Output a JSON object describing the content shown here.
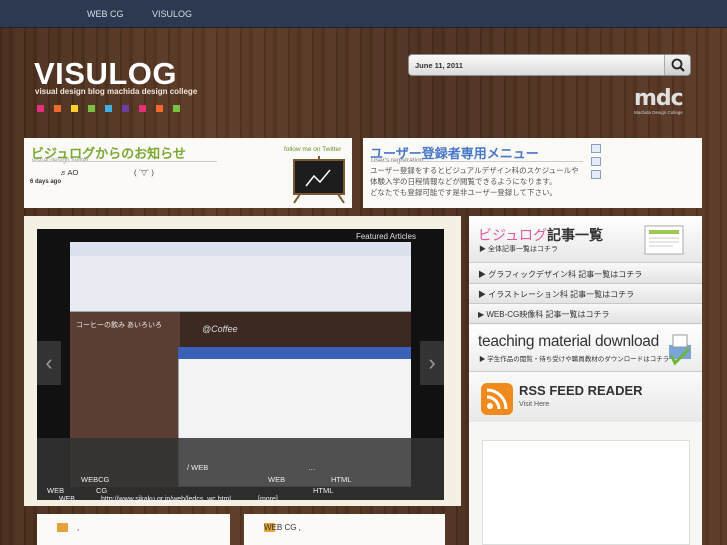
{
  "topnav": [
    "WEB CG",
    "VISULOG"
  ],
  "header": {
    "logo": "VISULOG",
    "tagline": "visual design blog machida design college",
    "square_colors": [
      "#e6307a",
      "#f26a2a",
      "#fcd12a",
      "#7ac143",
      "#3fb0e4",
      "#6b3fa0",
      "#e6307a",
      "#f26a2a",
      "#7ac143"
    ],
    "date": "June 11, 2011",
    "brand": "mdc",
    "brand_sub": "Machida Design College"
  },
  "news": {
    "title": "ビジュログからのお知らせ",
    "subtitle": "visual design twitter",
    "follow": "follow me on Twitter",
    "item_text": "♬AO",
    "item_emoticon": "( ´▽` )",
    "age": "6 days ago"
  },
  "registration": {
    "title": "ユーザー登録者専用メニュー",
    "subtitle": "User's registration",
    "lines": [
      "ユーザー登録をするとビジュアルデザイン科のスケジュールや",
      "体験入学の日程情報などが閲覧できるようになります。",
      "どなたでも登録可能です是非ユーザー登録して下さい。"
    ]
  },
  "slider": {
    "featured_label": "Featured Articles",
    "prev_icon": "chevron-left-icon",
    "next_icon": "chevron-right-icon",
    "overlay": {
      "line1_a": "/ WEB",
      "line1_b": "…",
      "line2_a": "WEB",
      "line2_b": "HTML",
      "line3_a": "WEBCG",
      "line4_a": "WEB",
      "line4_b": "CG",
      "line4_c": "HTML",
      "line5_a": "WEB",
      "line5_b": "http://www.sikaku.gr.jp/web/ledcs_wc.html",
      "line5_c": "[more]"
    },
    "screenshot_text": "@Coffee",
    "screenshot_heading": "コーヒーの飲み あいろいろ"
  },
  "sidebar": {
    "articles_title_a": "ビジュログ",
    "articles_title_b": "記事一覧",
    "articles_sub": "▶ 全体記事一覧はコチラ",
    "menu": [
      "▶ グラフィックデザイン科 記事一覧はコチラ",
      "▶ イラストレーション科 記事一覧はコチラ",
      "▶ WEB-CG映像科 記事一覧はコチラ"
    ],
    "teaching_title": "teaching material download",
    "teaching_sub": "▶ 学生作品の閲覧・待ち受けや職員教材のダウンロードはコチラ",
    "rss_title": "RSS FEED READER",
    "rss_sub": "Visit Here"
  },
  "cards": [
    ",",
    "WEB CG ,"
  ]
}
